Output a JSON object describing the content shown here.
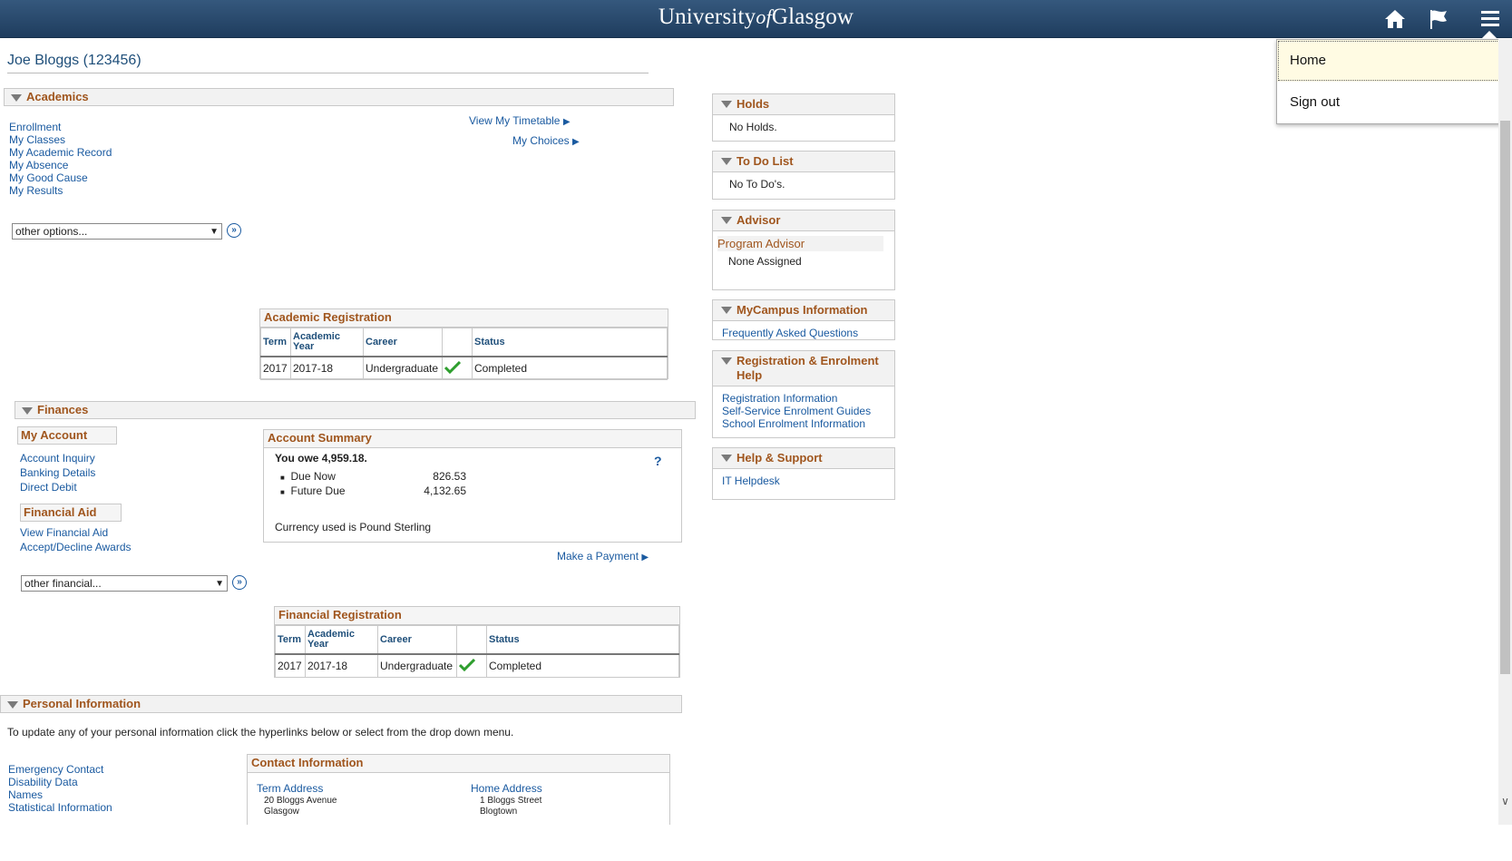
{
  "header": {
    "brand_main": "University",
    "brand_of": "of",
    "brand_end": "Glasgow",
    "icons": [
      "home-icon",
      "flag-icon",
      "menu-icon"
    ]
  },
  "menu": {
    "items": [
      "Home",
      "Sign out"
    ]
  },
  "user": {
    "name": "Joe Bloggs (123456)"
  },
  "academics": {
    "title": "Academics",
    "links": [
      "Enrollment",
      "My Classes",
      "My Academic Record",
      "My Absence",
      "My Good Cause",
      "My Results"
    ],
    "timetable_link": "View My Timetable",
    "choices_link": "My Choices",
    "select_value": "other options...",
    "registration": {
      "title": "Academic Registration",
      "headers": [
        "Term",
        "Academic Year",
        "Career",
        "",
        "Status"
      ],
      "row": [
        "2017",
        "2017-18",
        "Undergraduate",
        "",
        "Completed"
      ]
    }
  },
  "finances": {
    "title": "Finances",
    "my_account": "My Account",
    "account_links": [
      "Account Inquiry",
      "Banking Details",
      "Direct Debit"
    ],
    "financial_aid": "Financial Aid",
    "aid_links": [
      "View Financial Aid",
      "Accept/Decline Awards"
    ],
    "select_value": "other financial...",
    "summary": {
      "title": "Account Summary",
      "owe": "You owe 4,959.18.",
      "help": "?",
      "rows": [
        {
          "label": "Due Now",
          "value": "826.53"
        },
        {
          "label": "Future Due",
          "value": "4,132.65"
        }
      ],
      "currency": "Currency used is Pound Sterling"
    },
    "payment_link": "Make a Payment",
    "registration": {
      "title": "Financial Registration",
      "headers": [
        "Term",
        "Academic Year",
        "Career",
        "",
        "Status"
      ],
      "row": [
        "2017",
        "2017-18",
        "Undergraduate",
        "",
        "Completed"
      ]
    }
  },
  "personal": {
    "title": "Personal Information",
    "intro": "To update any of your personal information click the hyperlinks below or select from the drop down menu.",
    "links": [
      "Emergency Contact",
      "Disability Data",
      "Names",
      "Statistical Information"
    ],
    "contact": {
      "title": "Contact Information",
      "term_label": "Term Address",
      "term_lines": [
        "20 Bloggs Avenue",
        "Glasgow"
      ],
      "home_label": "Home Address",
      "home_lines": [
        "1 Bloggs Street",
        "Blogtown"
      ]
    }
  },
  "sidebar": {
    "holds": {
      "title": "Holds",
      "text": "No Holds."
    },
    "todo": {
      "title": "To Do List",
      "text": "No To Do's."
    },
    "advisor": {
      "title": "Advisor",
      "label": "Program Advisor",
      "text": "None Assigned"
    },
    "mycampus": {
      "title": "MyCampus Information",
      "links": [
        "Frequently Asked Questions"
      ]
    },
    "registration_help": {
      "title": "Registration & Enrolment Help",
      "links": [
        "Registration Information",
        "Self-Service Enrolment Guides",
        "School Enrolment Information"
      ]
    },
    "help": {
      "title": "Help & Support",
      "links": [
        "IT Helpdesk"
      ]
    }
  },
  "colors": {
    "header": "#2a4a6f",
    "accent": "#a0561e",
    "link": "#1a5aa0",
    "check": "#2e9e2e"
  }
}
